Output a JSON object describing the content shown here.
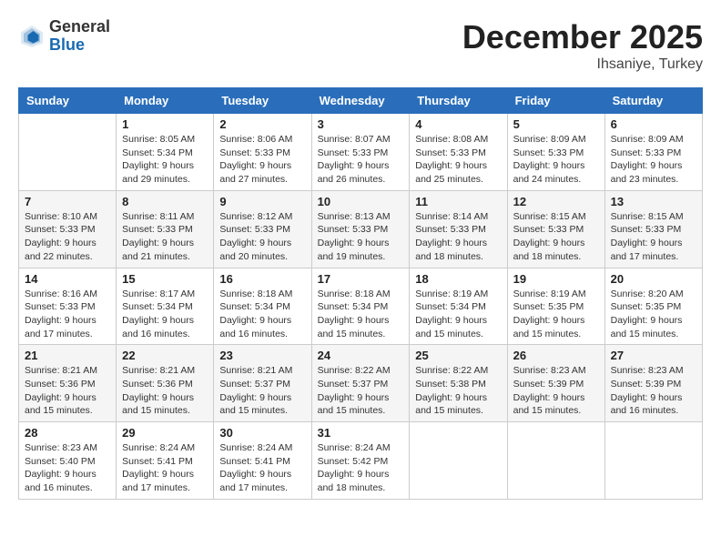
{
  "header": {
    "logo_general": "General",
    "logo_blue": "Blue",
    "month": "December 2025",
    "location": "Ihsaniye, Turkey"
  },
  "days_of_week": [
    "Sunday",
    "Monday",
    "Tuesday",
    "Wednesday",
    "Thursday",
    "Friday",
    "Saturday"
  ],
  "weeks": [
    [
      {
        "day": "",
        "info": ""
      },
      {
        "day": "1",
        "info": "Sunrise: 8:05 AM\nSunset: 5:34 PM\nDaylight: 9 hours\nand 29 minutes."
      },
      {
        "day": "2",
        "info": "Sunrise: 8:06 AM\nSunset: 5:33 PM\nDaylight: 9 hours\nand 27 minutes."
      },
      {
        "day": "3",
        "info": "Sunrise: 8:07 AM\nSunset: 5:33 PM\nDaylight: 9 hours\nand 26 minutes."
      },
      {
        "day": "4",
        "info": "Sunrise: 8:08 AM\nSunset: 5:33 PM\nDaylight: 9 hours\nand 25 minutes."
      },
      {
        "day": "5",
        "info": "Sunrise: 8:09 AM\nSunset: 5:33 PM\nDaylight: 9 hours\nand 24 minutes."
      },
      {
        "day": "6",
        "info": "Sunrise: 8:09 AM\nSunset: 5:33 PM\nDaylight: 9 hours\nand 23 minutes."
      }
    ],
    [
      {
        "day": "7",
        "info": "Sunrise: 8:10 AM\nSunset: 5:33 PM\nDaylight: 9 hours\nand 22 minutes."
      },
      {
        "day": "8",
        "info": "Sunrise: 8:11 AM\nSunset: 5:33 PM\nDaylight: 9 hours\nand 21 minutes."
      },
      {
        "day": "9",
        "info": "Sunrise: 8:12 AM\nSunset: 5:33 PM\nDaylight: 9 hours\nand 20 minutes."
      },
      {
        "day": "10",
        "info": "Sunrise: 8:13 AM\nSunset: 5:33 PM\nDaylight: 9 hours\nand 19 minutes."
      },
      {
        "day": "11",
        "info": "Sunrise: 8:14 AM\nSunset: 5:33 PM\nDaylight: 9 hours\nand 18 minutes."
      },
      {
        "day": "12",
        "info": "Sunrise: 8:15 AM\nSunset: 5:33 PM\nDaylight: 9 hours\nand 18 minutes."
      },
      {
        "day": "13",
        "info": "Sunrise: 8:15 AM\nSunset: 5:33 PM\nDaylight: 9 hours\nand 17 minutes."
      }
    ],
    [
      {
        "day": "14",
        "info": "Sunrise: 8:16 AM\nSunset: 5:33 PM\nDaylight: 9 hours\nand 17 minutes."
      },
      {
        "day": "15",
        "info": "Sunrise: 8:17 AM\nSunset: 5:34 PM\nDaylight: 9 hours\nand 16 minutes."
      },
      {
        "day": "16",
        "info": "Sunrise: 8:18 AM\nSunset: 5:34 PM\nDaylight: 9 hours\nand 16 minutes."
      },
      {
        "day": "17",
        "info": "Sunrise: 8:18 AM\nSunset: 5:34 PM\nDaylight: 9 hours\nand 15 minutes."
      },
      {
        "day": "18",
        "info": "Sunrise: 8:19 AM\nSunset: 5:34 PM\nDaylight: 9 hours\nand 15 minutes."
      },
      {
        "day": "19",
        "info": "Sunrise: 8:19 AM\nSunset: 5:35 PM\nDaylight: 9 hours\nand 15 minutes."
      },
      {
        "day": "20",
        "info": "Sunrise: 8:20 AM\nSunset: 5:35 PM\nDaylight: 9 hours\nand 15 minutes."
      }
    ],
    [
      {
        "day": "21",
        "info": "Sunrise: 8:21 AM\nSunset: 5:36 PM\nDaylight: 9 hours\nand 15 minutes."
      },
      {
        "day": "22",
        "info": "Sunrise: 8:21 AM\nSunset: 5:36 PM\nDaylight: 9 hours\nand 15 minutes."
      },
      {
        "day": "23",
        "info": "Sunrise: 8:21 AM\nSunset: 5:37 PM\nDaylight: 9 hours\nand 15 minutes."
      },
      {
        "day": "24",
        "info": "Sunrise: 8:22 AM\nSunset: 5:37 PM\nDaylight: 9 hours\nand 15 minutes."
      },
      {
        "day": "25",
        "info": "Sunrise: 8:22 AM\nSunset: 5:38 PM\nDaylight: 9 hours\nand 15 minutes."
      },
      {
        "day": "26",
        "info": "Sunrise: 8:23 AM\nSunset: 5:39 PM\nDaylight: 9 hours\nand 15 minutes."
      },
      {
        "day": "27",
        "info": "Sunrise: 8:23 AM\nSunset: 5:39 PM\nDaylight: 9 hours\nand 16 minutes."
      }
    ],
    [
      {
        "day": "28",
        "info": "Sunrise: 8:23 AM\nSunset: 5:40 PM\nDaylight: 9 hours\nand 16 minutes."
      },
      {
        "day": "29",
        "info": "Sunrise: 8:24 AM\nSunset: 5:41 PM\nDaylight: 9 hours\nand 17 minutes."
      },
      {
        "day": "30",
        "info": "Sunrise: 8:24 AM\nSunset: 5:41 PM\nDaylight: 9 hours\nand 17 minutes."
      },
      {
        "day": "31",
        "info": "Sunrise: 8:24 AM\nSunset: 5:42 PM\nDaylight: 9 hours\nand 18 minutes."
      },
      {
        "day": "",
        "info": ""
      },
      {
        "day": "",
        "info": ""
      },
      {
        "day": "",
        "info": ""
      }
    ]
  ]
}
